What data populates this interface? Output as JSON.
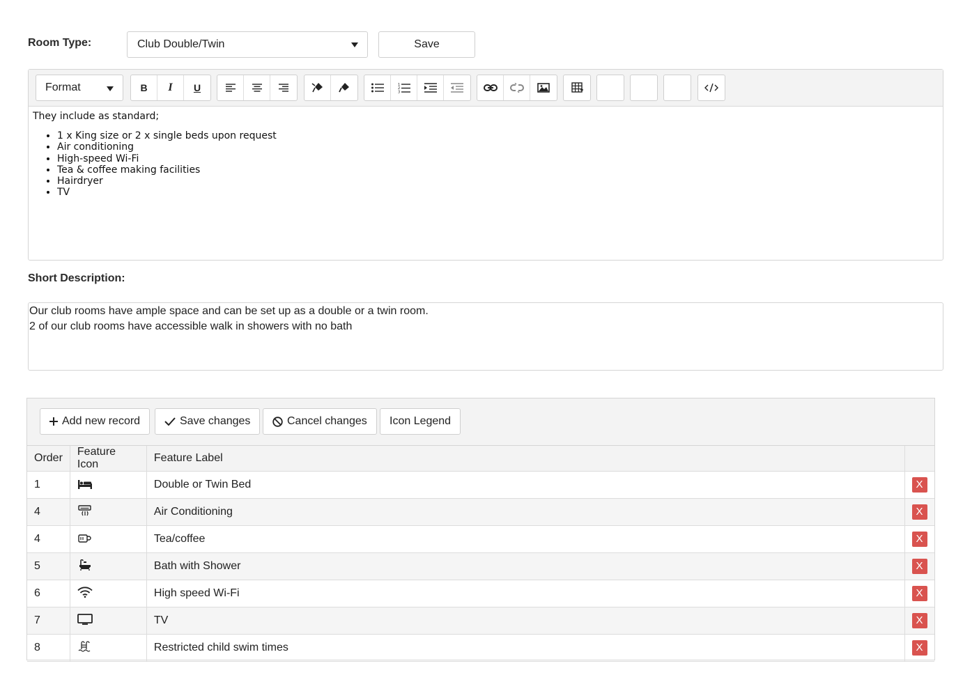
{
  "room": {
    "label": "Room Type:",
    "selected": "Club Double/Twin",
    "save_label": "Save"
  },
  "editor": {
    "format_label": "Format",
    "toolbar": {
      "bold": "B",
      "italic": "I",
      "underline": "U"
    },
    "content": {
      "intro": "They include as standard;",
      "items": [
        "1 x King size or 2 x single beds upon request",
        "Air conditioning",
        "High-speed Wi-Fi",
        "Tea & coffee making facilities",
        "Hairdryer",
        "TV"
      ]
    }
  },
  "short_description": {
    "label": "Short Description:",
    "line1": "Our club rooms have ample space and can be set up as a double or a twin room.",
    "line2": "2 of our club rooms have accessible walk in showers with no bath"
  },
  "grid": {
    "toolbar": {
      "add": "Add new record",
      "save": "Save changes",
      "cancel": "Cancel changes",
      "legend": "Icon Legend"
    },
    "headers": {
      "order": "Order",
      "icon": "Feature Icon",
      "label": "Feature Label"
    },
    "delete_label": "X",
    "rows": [
      {
        "order": "1",
        "icon": "bed-icon",
        "label": "Double or Twin Bed"
      },
      {
        "order": "4",
        "icon": "air-conditioner-icon",
        "label": "Air Conditioning"
      },
      {
        "order": "4",
        "icon": "mug-icon",
        "label": "Tea/coffee"
      },
      {
        "order": "5",
        "icon": "bath-icon",
        "label": "Bath with Shower"
      },
      {
        "order": "6",
        "icon": "wifi-icon",
        "label": "High speed Wi-Fi"
      },
      {
        "order": "7",
        "icon": "tv-icon",
        "label": "TV"
      },
      {
        "order": "8",
        "icon": "swimming-icon",
        "label": "Restricted child swim times"
      }
    ]
  },
  "colors": {
    "delete_button": "#d9534f",
    "toolbar_bg": "#f3f3f3"
  }
}
